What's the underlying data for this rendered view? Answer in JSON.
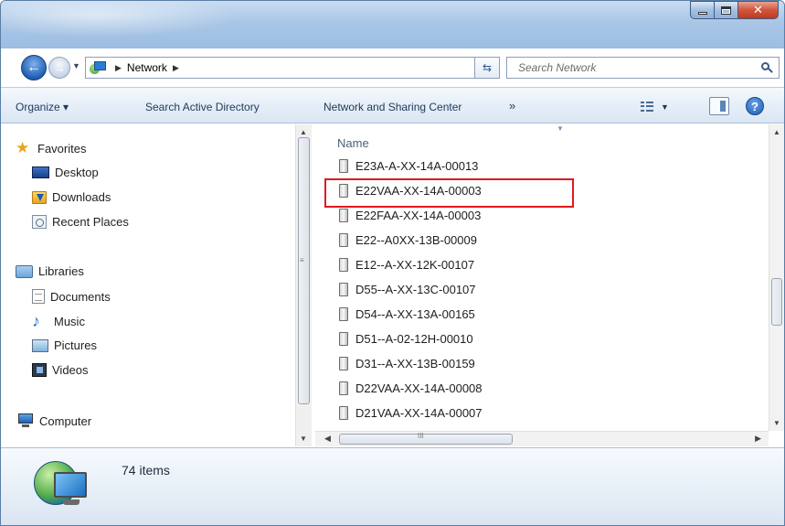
{
  "address": {
    "crumbs": [
      "Network"
    ],
    "search_placeholder": "Search Network"
  },
  "toolbar": {
    "organize": "Organize ▾",
    "search_ad": "Search Active Directory",
    "network_sharing": "Network and Sharing Center",
    "more": "»"
  },
  "navigation": {
    "favorites": "Favorites",
    "desktop": "Desktop",
    "downloads": "Downloads",
    "recent_places": "Recent Places",
    "libraries": "Libraries",
    "documents": "Documents",
    "music": "Music",
    "pictures": "Pictures",
    "videos": "Videos",
    "computer": "Computer"
  },
  "content": {
    "column_name": "Name",
    "files": [
      "E23A-A-XX-14A-00013",
      "E22VAA-XX-14A-00003",
      "E22FAA-XX-14A-00003",
      "E22--A0XX-13B-00009",
      "E12--A-XX-12K-00107",
      "D55--A-XX-13C-00107",
      "D54--A-XX-13A-00165",
      "D51--A-02-12H-00010",
      "D31--A-XX-13B-00159",
      "D22VAA-XX-14A-00008",
      "D21VAA-XX-14A-00007"
    ],
    "highlighted_file": "E22VAA-XX-14A-00003"
  },
  "details": {
    "item_count": "74 items"
  },
  "colors": {
    "highlight": "#e0191e",
    "toolbar_text": "#1e395b",
    "title_bar": "#a9c6e6"
  }
}
